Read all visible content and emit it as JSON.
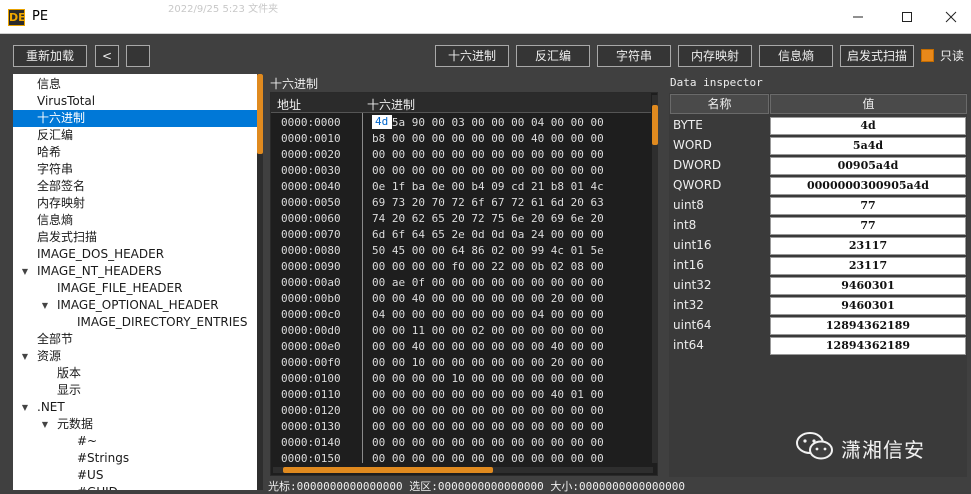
{
  "window": {
    "title": "PE",
    "app_icon_letters": "DE",
    "background_ghost_text": "2022/9/25 5:23   文件夹"
  },
  "toolbar": {
    "reload_label": "重新加载",
    "back_label": "<",
    "forward_label": "",
    "tabs": [
      "十六进制",
      "反汇编",
      "字符串",
      "内存映射",
      "信息熵",
      "启发式扫描"
    ],
    "readonly_label": "只读",
    "readonly_checked": true
  },
  "tree": {
    "items": [
      {
        "label": "信息",
        "level": 1,
        "arrow": ""
      },
      {
        "label": "VirusTotal",
        "level": 1,
        "arrow": ""
      },
      {
        "label": "十六进制",
        "level": 1,
        "arrow": "",
        "selected": true
      },
      {
        "label": "反汇编",
        "level": 1,
        "arrow": ""
      },
      {
        "label": "哈希",
        "level": 1,
        "arrow": ""
      },
      {
        "label": "字符串",
        "level": 1,
        "arrow": ""
      },
      {
        "label": "全部签名",
        "level": 1,
        "arrow": ""
      },
      {
        "label": "内存映射",
        "level": 1,
        "arrow": ""
      },
      {
        "label": "信息熵",
        "level": 1,
        "arrow": ""
      },
      {
        "label": "启发式扫描",
        "level": 1,
        "arrow": ""
      },
      {
        "label": "IMAGE_DOS_HEADER",
        "level": 1,
        "arrow": ""
      },
      {
        "label": "IMAGE_NT_HEADERS",
        "level": 1,
        "arrow": "▼"
      },
      {
        "label": "IMAGE_FILE_HEADER",
        "level": 2,
        "arrow": ""
      },
      {
        "label": "IMAGE_OPTIONAL_HEADER",
        "level": 2,
        "arrow": "▼"
      },
      {
        "label": "IMAGE_DIRECTORY_ENTRIES",
        "level": 3,
        "arrow": ""
      },
      {
        "label": "全部节",
        "level": 1,
        "arrow": ""
      },
      {
        "label": "资源",
        "level": 1,
        "arrow": "▼"
      },
      {
        "label": "版本",
        "level": 2,
        "arrow": ""
      },
      {
        "label": "显示",
        "level": 2,
        "arrow": ""
      },
      {
        "label": ".NET",
        "level": 1,
        "arrow": "▼"
      },
      {
        "label": "元数据",
        "level": 2,
        "arrow": "▼"
      },
      {
        "label": "#~",
        "level": 3,
        "arrow": ""
      },
      {
        "label": "#Strings",
        "level": 3,
        "arrow": ""
      },
      {
        "label": "#US",
        "level": 3,
        "arrow": ""
      },
      {
        "label": "#GUID",
        "level": 3,
        "arrow": ""
      }
    ]
  },
  "hex": {
    "title": "十六进制",
    "col_address": "地址",
    "col_hex": "十六进制",
    "selected_byte": "4d",
    "rows": [
      {
        "addr": "0000:0000",
        "bytes": "4d 5a 90 00 03 00 00 00 04 00 00 00"
      },
      {
        "addr": "0000:0010",
        "bytes": "b8 00 00 00 00 00 00 00 40 00 00 00"
      },
      {
        "addr": "0000:0020",
        "bytes": "00 00 00 00 00 00 00 00 00 00 00 00"
      },
      {
        "addr": "0000:0030",
        "bytes": "00 00 00 00 00 00 00 00 00 00 00 00"
      },
      {
        "addr": "0000:0040",
        "bytes": "0e 1f ba 0e 00 b4 09 cd 21 b8 01 4c"
      },
      {
        "addr": "0000:0050",
        "bytes": "69 73 20 70 72 6f 67 72 61 6d 20 63"
      },
      {
        "addr": "0000:0060",
        "bytes": "74 20 62 65 20 72 75 6e 20 69 6e 20"
      },
      {
        "addr": "0000:0070",
        "bytes": "6d 6f 64 65 2e 0d 0d 0a 24 00 00 00"
      },
      {
        "addr": "0000:0080",
        "bytes": "50 45 00 00 64 86 02 00 99 4c 01 5e"
      },
      {
        "addr": "0000:0090",
        "bytes": "00 00 00 00 f0 00 22 00 0b 02 08 00"
      },
      {
        "addr": "0000:00a0",
        "bytes": "00 ae 0f 00 00 00 00 00 00 00 00 00"
      },
      {
        "addr": "0000:00b0",
        "bytes": "00 00 40 00 00 00 00 00 00 20 00 00"
      },
      {
        "addr": "0000:00c0",
        "bytes": "04 00 00 00 00 00 00 00 04 00 00 00"
      },
      {
        "addr": "0000:00d0",
        "bytes": "00 00 11 00 00 02 00 00 00 00 00 00"
      },
      {
        "addr": "0000:00e0",
        "bytes": "00 00 40 00 00 00 00 00 00 40 00 00"
      },
      {
        "addr": "0000:00f0",
        "bytes": "00 00 10 00 00 00 00 00 00 20 00 00"
      },
      {
        "addr": "0000:0100",
        "bytes": "00 00 00 00 10 00 00 00 00 00 00 00"
      },
      {
        "addr": "0000:0110",
        "bytes": "00 00 00 00 00 00 00 00 00 40 01 00"
      },
      {
        "addr": "0000:0120",
        "bytes": "00 00 00 00 00 00 00 00 00 00 00 00"
      },
      {
        "addr": "0000:0130",
        "bytes": "00 00 00 00 00 00 00 00 00 00 00 00"
      },
      {
        "addr": "0000:0140",
        "bytes": "00 00 00 00 00 00 00 00 00 00 00 00"
      },
      {
        "addr": "0000:0150",
        "bytes": "00 00 00 00 00 00 00 00 00 00 00 00"
      }
    ]
  },
  "status": {
    "text": "光标:0000000000000000  选区:0000000000000000  大小:0000000000000000"
  },
  "inspector": {
    "title": "Data inspector",
    "col_name": "名称",
    "col_value": "值",
    "rows": [
      {
        "name": "BYTE",
        "value": "4d"
      },
      {
        "name": "WORD",
        "value": "5a4d"
      },
      {
        "name": "DWORD",
        "value": "00905a4d"
      },
      {
        "name": "QWORD",
        "value": "0000000300905a4d"
      },
      {
        "name": "uint8",
        "value": "77"
      },
      {
        "name": "int8",
        "value": "77"
      },
      {
        "name": "uint16",
        "value": "23117"
      },
      {
        "name": "int16",
        "value": "23117"
      },
      {
        "name": "uint32",
        "value": "9460301"
      },
      {
        "name": "int32",
        "value": "9460301"
      },
      {
        "name": "uint64",
        "value": "12894362189"
      },
      {
        "name": "int64",
        "value": "12894362189"
      }
    ]
  },
  "watermark": {
    "text": "潇湘信安"
  },
  "colors": {
    "accent": "#e08a1f",
    "selection": "#0078d7",
    "background": "#404040"
  }
}
